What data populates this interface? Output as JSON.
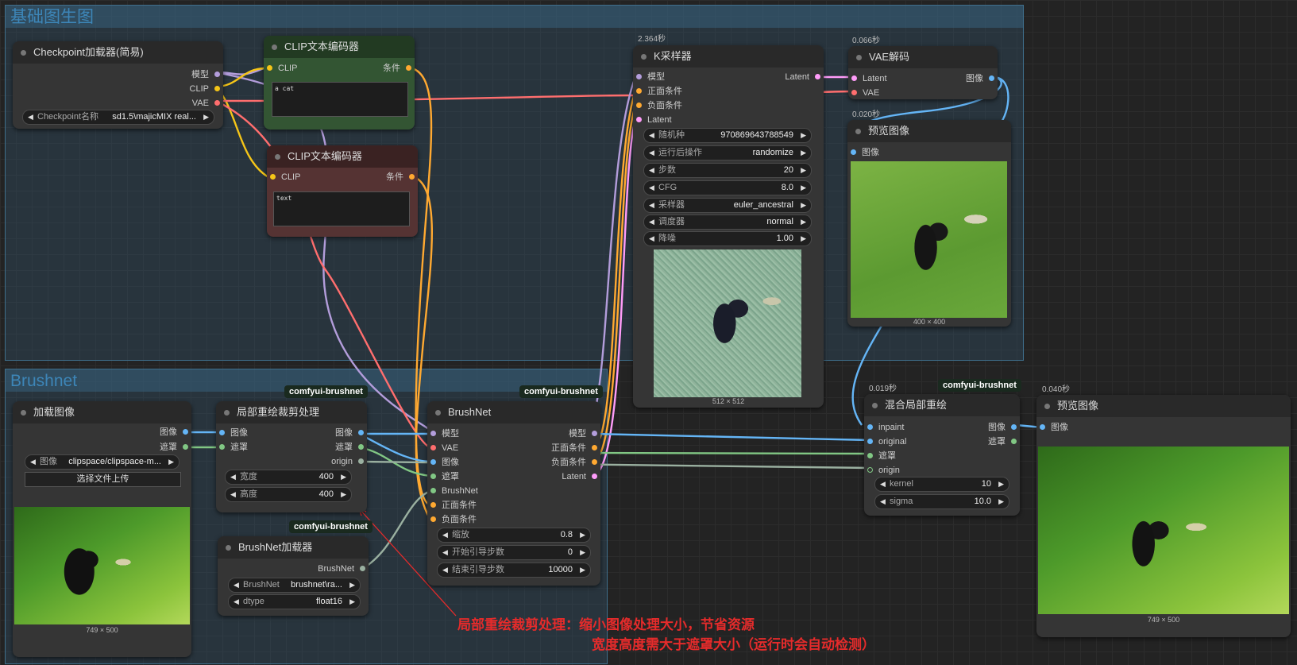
{
  "groups": {
    "base": {
      "title": "基础图生图"
    },
    "brushnet": {
      "title": "Brushnet"
    }
  },
  "tags": {
    "brushnet_tag": "comfyui-brushnet"
  },
  "checkpoint_node": {
    "title": "Checkpoint加载器(简易)",
    "outputs": [
      "模型",
      "CLIP",
      "VAE"
    ],
    "ckpt_label": "Checkpoint名称",
    "ckpt_value": "sd1.5\\majicMIX real..."
  },
  "clip_pos": {
    "title": "CLIP文本编码器",
    "input": "CLIP",
    "output": "条件",
    "text": "a cat"
  },
  "clip_neg": {
    "title": "CLIP文本编码器",
    "input": "CLIP",
    "output": "条件",
    "text": "text"
  },
  "ksampler": {
    "time": "2.364秒",
    "title": "K采样器",
    "inputs": [
      "模型",
      "正面条件",
      "负面条件",
      "Latent"
    ],
    "output": "Latent",
    "widgets": [
      {
        "label": "随机种",
        "value": "970869643788549"
      },
      {
        "label": "运行后操作",
        "value": "randomize"
      },
      {
        "label": "步数",
        "value": "20"
      },
      {
        "label": "CFG",
        "value": "8.0"
      },
      {
        "label": "采样器",
        "value": "euler_ancestral"
      },
      {
        "label": "调度器",
        "value": "normal"
      },
      {
        "label": "降噪",
        "value": "1.00"
      }
    ],
    "image_size": "512 × 512"
  },
  "vae_decode": {
    "time": "0.066秒",
    "title": "VAE解码",
    "inputs": [
      "Latent",
      "VAE"
    ],
    "output": "图像"
  },
  "preview1": {
    "time": "0.020秒",
    "title": "预览图像",
    "input": "图像",
    "image_size": "400 × 400"
  },
  "load_image": {
    "title": "加载图像",
    "outputs": [
      "图像",
      "遮罩"
    ],
    "image_label": "图像",
    "image_value": "clipspace/clipspace-m...",
    "upload_label": "选择文件上传",
    "image_size": "749 × 500"
  },
  "crop_node": {
    "title": "局部重绘裁剪处理",
    "inputs": [
      "图像",
      "遮罩"
    ],
    "outputs": [
      "图像",
      "遮罩",
      "origin"
    ],
    "widgets": [
      {
        "label": "宽度",
        "value": "400"
      },
      {
        "label": "高度",
        "value": "400"
      }
    ]
  },
  "brushnet_loader": {
    "title": "BrushNet加载器",
    "output": "BrushNet",
    "widgets": [
      {
        "label": "BrushNet",
        "value": "brushnet\\ra..."
      },
      {
        "label": "dtype",
        "value": "float16"
      }
    ]
  },
  "brushnet_node": {
    "title": "BrushNet",
    "inputs": [
      "模型",
      "VAE",
      "图像",
      "遮罩",
      "BrushNet",
      "正面条件",
      "负面条件"
    ],
    "outputs": [
      "模型",
      "正面条件",
      "负面条件",
      "Latent"
    ],
    "widgets": [
      {
        "label": "缩放",
        "value": "0.8"
      },
      {
        "label": "开始引导步数",
        "value": "0"
      },
      {
        "label": "结束引导步数",
        "value": "10000"
      }
    ]
  },
  "blend_node": {
    "time": "0.019秒",
    "title": "混合局部重绘",
    "inputs": [
      "inpaint",
      "original",
      "遮罩",
      "origin"
    ],
    "outputs": [
      "图像",
      "遮罩"
    ],
    "widgets": [
      {
        "label": "kernel",
        "value": "10"
      },
      {
        "label": "sigma",
        "value": "10.0"
      }
    ]
  },
  "preview2": {
    "time": "0.040秒",
    "title": "预览图像",
    "input": "图像",
    "image_size": "749 × 500"
  },
  "annotation": {
    "line1": "局部重绘裁剪处理：缩小图像处理大小，节省资源",
    "line2": "宽度高度需大于遮罩大小（运行时会自动检测）"
  },
  "colors": {
    "model": "#b39ddb",
    "clip": "#f5c518",
    "vae": "#ff6e6e",
    "cond": "#ffa931",
    "latent": "#ff9cf9",
    "image": "#64b5f6",
    "mask": "#81c784",
    "accent_red": "#e52b2b"
  }
}
